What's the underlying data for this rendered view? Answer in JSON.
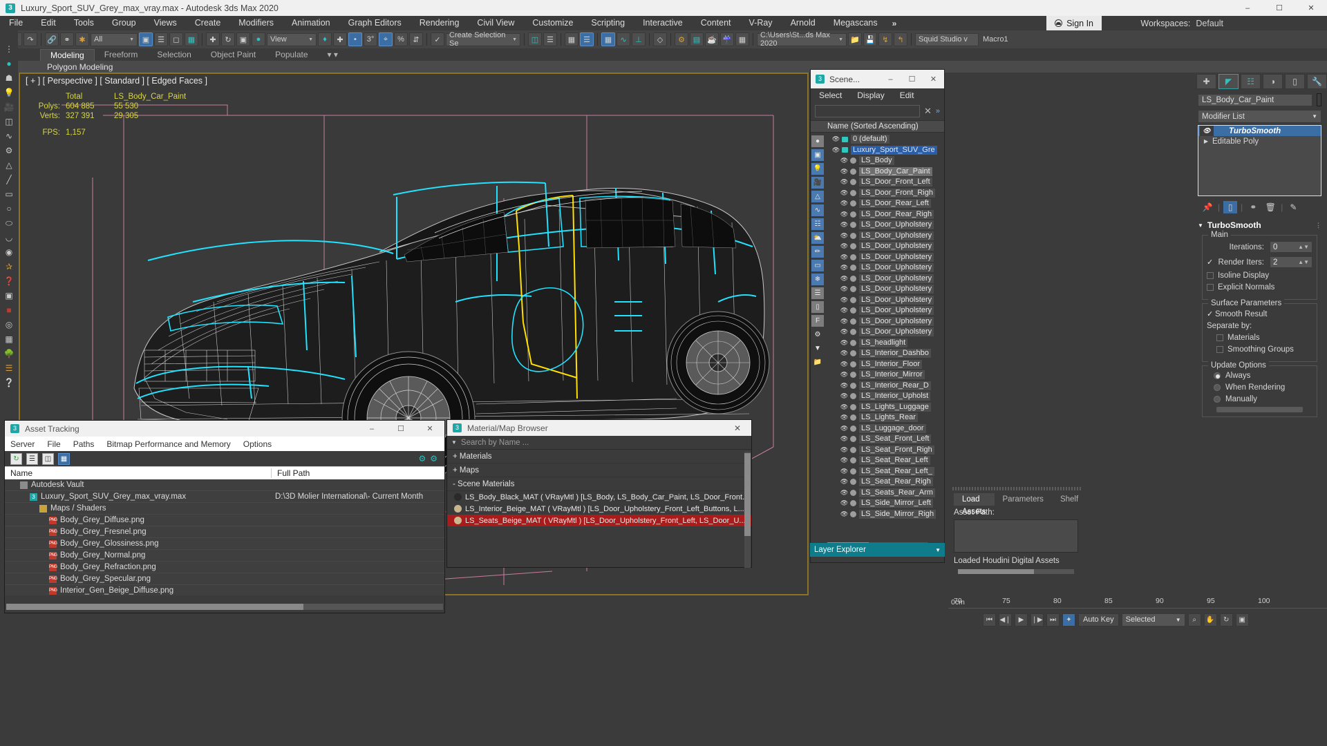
{
  "window": {
    "title": "Luxury_Sport_SUV_Grey_max_vray.max - Autodesk 3ds Max 2020",
    "app_badge": "3",
    "minimize": "–",
    "maximize": "☐",
    "close": "✕"
  },
  "menubar": {
    "items": [
      "File",
      "Edit",
      "Tools",
      "Group",
      "Views",
      "Create",
      "Modifiers",
      "Animation",
      "Graph Editors",
      "Rendering",
      "Civil View",
      "Customize",
      "Scripting",
      "Interactive",
      "Content",
      "V-Ray",
      "Arnold",
      "Megascans"
    ],
    "overflow": "»",
    "sign_in": "Sign In",
    "workspaces_label": "Workspaces:",
    "workspaces_value": "Default"
  },
  "toolbar": {
    "undo": "↶",
    "redo": "↷",
    "selection_filter": "All",
    "reference_coordinate": "View",
    "selection_set": "Create Selection Se",
    "project_folder": "C:\\Users\\St...ds Max 2020",
    "percent_label": "%"
  },
  "ribbon": {
    "tabs": [
      "Modeling",
      "Freeform",
      "Selection",
      "Object Paint",
      "Populate"
    ],
    "active_tab": "Modeling",
    "subtab": "Polygon Modeling"
  },
  "viewport": {
    "label": "[ + ] [ Perspective ] [ Standard ] [ Edged Faces ]",
    "stats": {
      "col_total": "Total",
      "col_object": "LS_Body_Car_Paint",
      "rows": [
        {
          "label": "Polys:",
          "total": "604 885",
          "object": "55 530"
        },
        {
          "label": "Verts:",
          "total": "327 391",
          "object": "29 305"
        }
      ],
      "fps_label": "FPS:",
      "fps_value": "1,157"
    }
  },
  "scene_explorer": {
    "title": "Scene...",
    "badge": "3",
    "menus": [
      "Select",
      "Display",
      "Edit"
    ],
    "search_value": "",
    "clear_icon": "✕",
    "column_header": "Name (Sorted Ascending)",
    "overflow": "»",
    "minimize": "–",
    "maximize": "☐",
    "close": "✕",
    "rows": [
      {
        "name": "0 (default)",
        "indent": 0,
        "type": "layer",
        "state": "none"
      },
      {
        "name": "Luxury_Sport_SUV_Gre",
        "indent": 0,
        "type": "layer",
        "state": "selected"
      },
      {
        "name": "LS_Body",
        "indent": 1,
        "type": "object",
        "state": "none"
      },
      {
        "name": "LS_Body_Car_Paint",
        "indent": 1,
        "type": "object",
        "state": "highlight"
      },
      {
        "name": "LS_Door_Front_Left",
        "indent": 1,
        "type": "object",
        "state": "none"
      },
      {
        "name": "LS_Door_Front_Righ",
        "indent": 1,
        "type": "object",
        "state": "none"
      },
      {
        "name": "LS_Door_Rear_Left",
        "indent": 1,
        "type": "object",
        "state": "none"
      },
      {
        "name": "LS_Door_Rear_Righ",
        "indent": 1,
        "type": "object",
        "state": "none"
      },
      {
        "name": "LS_Door_Upholstery",
        "indent": 1,
        "type": "object",
        "state": "none"
      },
      {
        "name": "LS_Door_Upholstery",
        "indent": 1,
        "type": "object",
        "state": "none"
      },
      {
        "name": "LS_Door_Upholstery",
        "indent": 1,
        "type": "object",
        "state": "none"
      },
      {
        "name": "LS_Door_Upholstery",
        "indent": 1,
        "type": "object",
        "state": "none"
      },
      {
        "name": "LS_Door_Upholstery",
        "indent": 1,
        "type": "object",
        "state": "none"
      },
      {
        "name": "LS_Door_Upholstery",
        "indent": 1,
        "type": "object",
        "state": "none"
      },
      {
        "name": "LS_Door_Upholstery",
        "indent": 1,
        "type": "object",
        "state": "none"
      },
      {
        "name": "LS_Door_Upholstery",
        "indent": 1,
        "type": "object",
        "state": "none"
      },
      {
        "name": "LS_Door_Upholstery",
        "indent": 1,
        "type": "object",
        "state": "none"
      },
      {
        "name": "LS_Door_Upholstery",
        "indent": 1,
        "type": "object",
        "state": "none"
      },
      {
        "name": "LS_Door_Upholstery",
        "indent": 1,
        "type": "object",
        "state": "none"
      },
      {
        "name": "LS_headlight",
        "indent": 1,
        "type": "object",
        "state": "none"
      },
      {
        "name": "LS_Interior_Dashbo",
        "indent": 1,
        "type": "object",
        "state": "none"
      },
      {
        "name": "LS_Interior_Floor",
        "indent": 1,
        "type": "object",
        "state": "none"
      },
      {
        "name": "LS_Interior_Mirror",
        "indent": 1,
        "type": "object",
        "state": "none"
      },
      {
        "name": "LS_Interior_Rear_D",
        "indent": 1,
        "type": "object",
        "state": "none"
      },
      {
        "name": "LS_Interior_Upholst",
        "indent": 1,
        "type": "object",
        "state": "none"
      },
      {
        "name": "LS_Lights_Luggage",
        "indent": 1,
        "type": "object",
        "state": "none"
      },
      {
        "name": "LS_Lights_Rear",
        "indent": 1,
        "type": "object",
        "state": "none"
      },
      {
        "name": "LS_Luggage_door",
        "indent": 1,
        "type": "object",
        "state": "none"
      },
      {
        "name": "LS_Seat_Front_Left",
        "indent": 1,
        "type": "object",
        "state": "none"
      },
      {
        "name": "LS_Seat_Front_Righ",
        "indent": 1,
        "type": "object",
        "state": "none"
      },
      {
        "name": "LS_Seat_Rear_Left",
        "indent": 1,
        "type": "object",
        "state": "none"
      },
      {
        "name": "LS_Seat_Rear_Left_",
        "indent": 1,
        "type": "object",
        "state": "none"
      },
      {
        "name": "LS_Seat_Rear_Righ",
        "indent": 1,
        "type": "object",
        "state": "none"
      },
      {
        "name": "LS_Seats_Rear_Arm",
        "indent": 1,
        "type": "object",
        "state": "none"
      },
      {
        "name": "LS_Side_Mirror_Left",
        "indent": 1,
        "type": "object",
        "state": "none"
      },
      {
        "name": "LS_Side_Mirror_Righ",
        "indent": 1,
        "type": "object",
        "state": "none"
      }
    ],
    "layer_explorer_tab": "Layer Explorer"
  },
  "command_panel": {
    "object_name": "LS_Body_Car_Paint",
    "modifier_list_label": "Modifier List",
    "stack": [
      {
        "label": "TurboSmooth",
        "selected": true
      },
      {
        "label": "Editable Poly",
        "selected": false
      }
    ],
    "rollout_title": "TurboSmooth",
    "main_group": "Main",
    "iterations_label": "Iterations:",
    "iterations_value": "0",
    "render_iters_label": "Render Iters:",
    "render_iters_value": "2",
    "isoline_display": "Isoline Display",
    "explicit_normals": "Explicit Normals",
    "surface_group": "Surface Parameters",
    "smooth_result": "Smooth Result",
    "separate_by": "Separate by:",
    "materials": "Materials",
    "smoothing_groups": "Smoothing Groups",
    "update_group": "Update Options",
    "update_options": [
      "Always",
      "When Rendering",
      "Manually"
    ],
    "update_selected": "Always"
  },
  "houdini_panel": {
    "tabs": [
      "Load Assets",
      "Parameters",
      "Shelf"
    ],
    "active_tab": "Load Assets",
    "asset_path_label": "Asset Path:",
    "loaded_label": "Loaded Houdini Digital Assets"
  },
  "asset_tracking": {
    "title": "Asset Tracking",
    "badge": "3",
    "menus": [
      "Server",
      "File",
      "Paths",
      "Bitmap Performance and Memory",
      "Options"
    ],
    "columns": [
      "Name",
      "Full Path"
    ],
    "minimize": "–",
    "maximize": "☐",
    "close": "✕",
    "rows": [
      {
        "name": "Autodesk Vault",
        "indent": 1,
        "icon": "vault",
        "path": ""
      },
      {
        "name": "Luxury_Sport_SUV_Grey_max_vray.max",
        "indent": 2,
        "icon": "max",
        "path": "D:\\3D Molier International\\- Current Month"
      },
      {
        "name": "Maps / Shaders",
        "indent": 3,
        "icon": "fld",
        "path": ""
      },
      {
        "name": "Body_Grey_Diffuse.png",
        "indent": 4,
        "icon": "png",
        "path": ""
      },
      {
        "name": "Body_Grey_Fresnel.png",
        "indent": 4,
        "icon": "png",
        "path": ""
      },
      {
        "name": "Body_Grey_Glossiness.png",
        "indent": 4,
        "icon": "png",
        "path": ""
      },
      {
        "name": "Body_Grey_Normal.png",
        "indent": 4,
        "icon": "png",
        "path": ""
      },
      {
        "name": "Body_Grey_Refraction.png",
        "indent": 4,
        "icon": "png",
        "path": ""
      },
      {
        "name": "Body_Grey_Specular.png",
        "indent": 4,
        "icon": "png",
        "path": ""
      },
      {
        "name": "Interior_Gen_Beige_Diffuse.png",
        "indent": 4,
        "icon": "png",
        "path": ""
      }
    ]
  },
  "material_browser": {
    "title": "Material/Map Browser",
    "badge": "3",
    "close": "✕",
    "search_placeholder": "Search by Name ...",
    "sections": [
      {
        "label": "+ Materials",
        "expanded": false
      },
      {
        "label": "+ Maps",
        "expanded": false
      },
      {
        "label": "- Scene Materials",
        "expanded": true
      }
    ],
    "scene_materials": [
      {
        "label": "LS_Body_Black_MAT ( VRayMtl ) [LS_Body, LS_Body_Car_Paint, LS_Door_Front...",
        "color": "#2a2a2a",
        "selected": false
      },
      {
        "label": "LS_Interior_Beige_MAT ( VRayMtl ) [LS_Door_Upholstery_Front_Left_Buttons, L...",
        "color": "#c8b58d",
        "selected": false
      },
      {
        "label": "LS_Seats_Beige_MAT ( VRayMtl ) [LS_Door_Upholstery_Front_Left, LS_Door_U...",
        "color": "#cbb88f",
        "selected": true
      }
    ]
  },
  "timebar": {
    "ticks": [
      "70",
      "75",
      "80",
      "85",
      "90",
      "95",
      "100"
    ],
    "origin": "0cm",
    "go_start": "⏮",
    "prev_frame": "◀❘",
    "play": "▶",
    "next_frame": "❘▶",
    "go_end": "⏭",
    "key_mode": "✦",
    "auto_key": "Auto Key",
    "selection_level": "Selected",
    "zoom_icon": "⌕"
  },
  "colors": {
    "accent_blue": "#3a6ea5",
    "teal": "#2fc0c0",
    "panel_bg": "#3b3b3b",
    "viewport_bg": "#3a3a3a",
    "stats_yellow": "#d6d64a",
    "selection_red": "#a81c1c",
    "layer_bar": "#0e7c8a",
    "viewport_border": "#8a7424"
  }
}
